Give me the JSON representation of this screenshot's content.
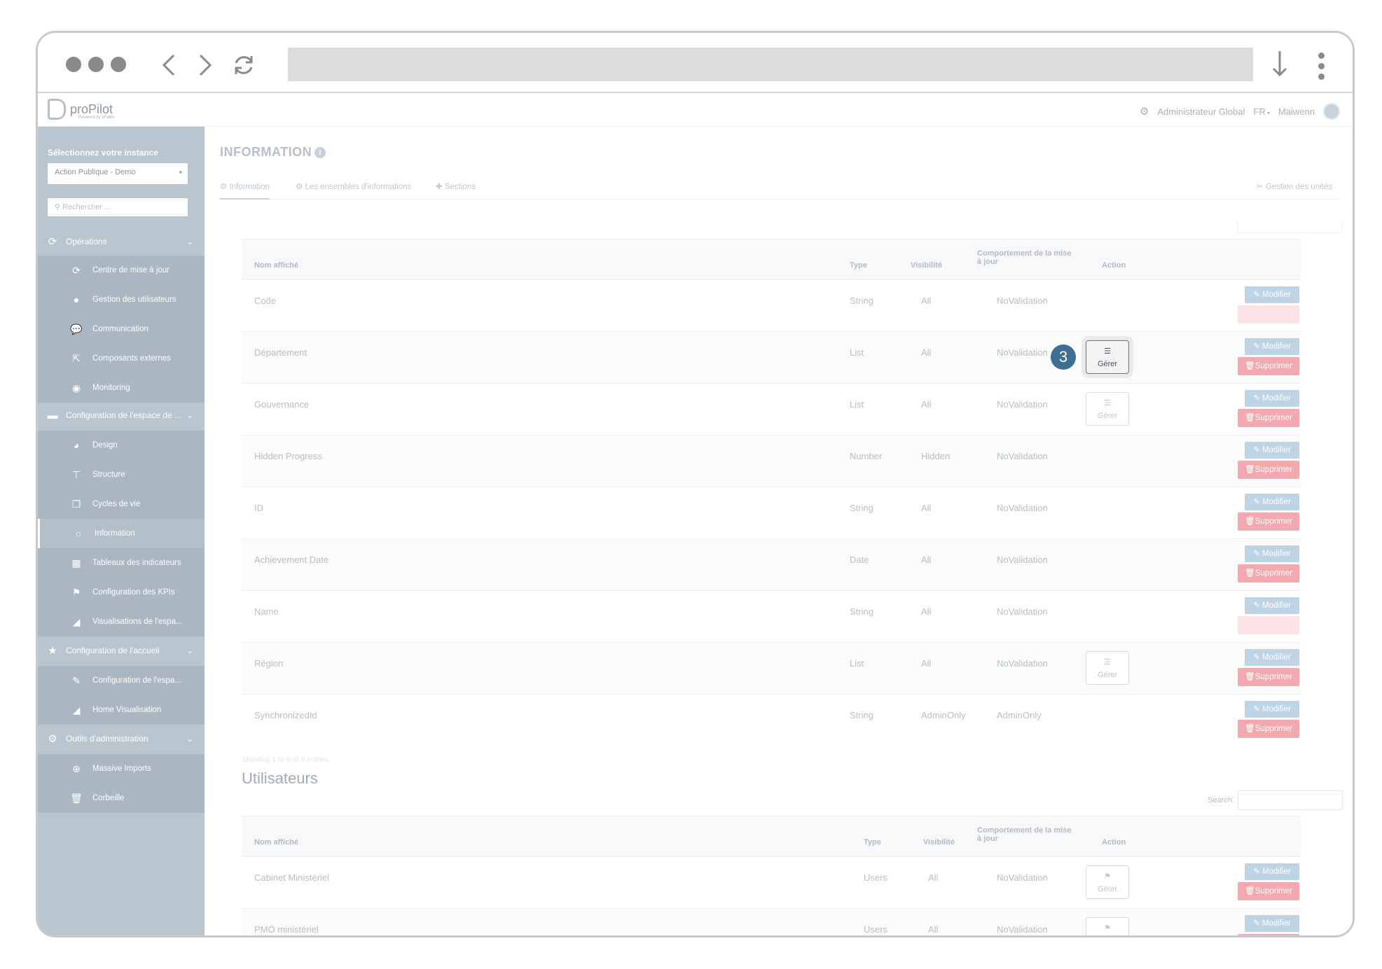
{
  "app": {
    "logo_text": "proPilot",
    "logo_sub": "Powered by eFakto",
    "role": "Administrateur Global",
    "lang": "FR",
    "user": "Maiwenn"
  },
  "sidebar": {
    "title": "Sélectionnez votre instance",
    "instance": "Action Publique - Demo",
    "search_placeholder": "Rechercher ...",
    "groups": [
      {
        "label": "Opérations",
        "icon": "refresh-icon"
      },
      {
        "label": "Configuration de l'espace de ...",
        "icon": "folder-icon"
      },
      {
        "label": "Configuration de l'accueil",
        "icon": "star-icon"
      },
      {
        "label": "Outils d'administration",
        "icon": "gear-icon"
      }
    ],
    "items": [
      {
        "label": "Centre de mise à jour",
        "icon": "refresh-icon"
      },
      {
        "label": "Gestion des utilisateurs",
        "icon": "user-icon"
      },
      {
        "label": "Communication",
        "icon": "chat-icon"
      },
      {
        "label": "Composants externes",
        "icon": "external-link-icon"
      },
      {
        "label": "Monitoring",
        "icon": "eye-icon"
      },
      {
        "label": "Design",
        "icon": "palette-icon"
      },
      {
        "label": "Structure",
        "icon": "sitemap-icon"
      },
      {
        "label": "Cycles de vie",
        "icon": "copy-icon"
      },
      {
        "label": "Information",
        "icon": "comment-icon"
      },
      {
        "label": "Tableaux des indicateurs",
        "icon": "table-icon"
      },
      {
        "label": "Configuration des KPIs",
        "icon": "flag-icon"
      },
      {
        "label": "Visualisations de l'espa...",
        "icon": "chart-icon"
      },
      {
        "label": "Configuration de l'espa...",
        "icon": "edit-icon"
      },
      {
        "label": "Home Visualisation",
        "icon": "chart-icon"
      },
      {
        "label": "Massive Imports",
        "icon": "download-icon"
      },
      {
        "label": "Corbeille",
        "icon": "trash-icon"
      }
    ]
  },
  "main": {
    "title": "INFORMATION",
    "tabs": [
      "Information",
      "Les ensembles d'informations",
      "Sections"
    ],
    "tab_right": "Gestion des unités",
    "columns": {
      "name": "Nom affiché",
      "type": "Type",
      "visibility": "Visibilité",
      "behavior_1": "Comportement de la mise",
      "behavior_2": "à jour",
      "action": "Action"
    },
    "buttons": {
      "manage": "Gérer",
      "edit": "Modifier",
      "delete": "Supprimer"
    },
    "rows": [
      {
        "name": "Code",
        "type": "String",
        "visibility": "All",
        "behavior": "NoValidation",
        "manage": false,
        "delete_disabled": true
      },
      {
        "name": "Département",
        "type": "List",
        "visibility": "All",
        "behavior": "NoValidation",
        "manage": true,
        "delete_disabled": false
      },
      {
        "name": "Gouvernance",
        "type": "List",
        "visibility": "All",
        "behavior": "NoValidation",
        "manage": true,
        "delete_disabled": false
      },
      {
        "name": "Hidden Progress",
        "type": "Number",
        "visibility": "Hidden",
        "behavior": "NoValidation",
        "manage": false,
        "delete_disabled": false
      },
      {
        "name": "ID",
        "type": "String",
        "visibility": "All",
        "behavior": "NoValidation",
        "manage": false,
        "delete_disabled": false
      },
      {
        "name": "Achievement Date",
        "type": "Date",
        "visibility": "All",
        "behavior": "NoValidation",
        "manage": false,
        "delete_disabled": false
      },
      {
        "name": "Name",
        "type": "String",
        "visibility": "All",
        "behavior": "NoValidation",
        "manage": false,
        "delete_disabled": true
      },
      {
        "name": "Région",
        "type": "List",
        "visibility": "All",
        "behavior": "NoValidation",
        "manage": true,
        "delete_disabled": false
      },
      {
        "name": "SynchronizedId",
        "type": "String",
        "visibility": "AdminOnly",
        "behavior": "AdminOnly",
        "manage": false,
        "delete_disabled": false
      }
    ],
    "footnote": "Showing 1 to 9 of 9 entries",
    "section2_title": "Utilisateurs",
    "search_label": "Search:",
    "rows2": [
      {
        "name": "Cabinet Ministériel",
        "type": "Users",
        "visibility": "All",
        "behavior": "NoValidation",
        "manage": true,
        "delete_disabled": false
      },
      {
        "name": "PMO ministériel",
        "type": "Users",
        "visibility": "All",
        "behavior": "NoValidation",
        "manage": true,
        "delete_disabled": false
      }
    ],
    "step_badge": "3"
  }
}
